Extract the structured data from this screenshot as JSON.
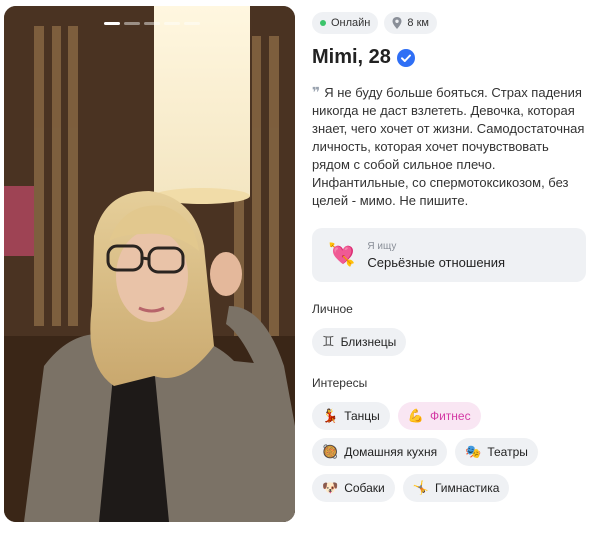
{
  "photo": {
    "alt_icon": "profile-photo",
    "dots_total": 5,
    "active_dot": 0
  },
  "status": {
    "online_label": "Онлайн",
    "distance_label": "8 км"
  },
  "profile": {
    "name_age": "Mimi, 28",
    "bio": "Я не буду больше бояться. Страх падения никогда не даст взлететь. Девочка, которая знает, чего хочет от жизни. Самодостаточная личность, которая хочет почувствовать рядом с собой сильное плечо. Инфантильные, со спермотоксикозом, без целей - мимо. Не пишите."
  },
  "seeking": {
    "label": "Я ищу",
    "value": "Серьёзные отношения",
    "icon": "heart-arrow-icon"
  },
  "personal": {
    "title": "Личное",
    "items": [
      {
        "label": "Близнецы",
        "icon": "gemini-icon"
      }
    ]
  },
  "interests": {
    "title": "Интересы",
    "items": [
      {
        "label": "Танцы",
        "emoji": "💃",
        "highlight": false
      },
      {
        "label": "Фитнес",
        "emoji": "💪",
        "highlight": true
      },
      {
        "label": "Домашняя кухня",
        "emoji": "🥘",
        "highlight": false
      },
      {
        "label": "Театры",
        "emoji": "🎭",
        "highlight": false
      },
      {
        "label": "Собаки",
        "emoji": "🐶",
        "highlight": false
      },
      {
        "label": "Гимнастика",
        "emoji": "🤸",
        "highlight": false
      }
    ]
  },
  "colors": {
    "online": "#3cc46b",
    "verified": "#2f6ff5",
    "highlight_text": "#d43aa5",
    "chip_bg": "#eff1f4"
  }
}
